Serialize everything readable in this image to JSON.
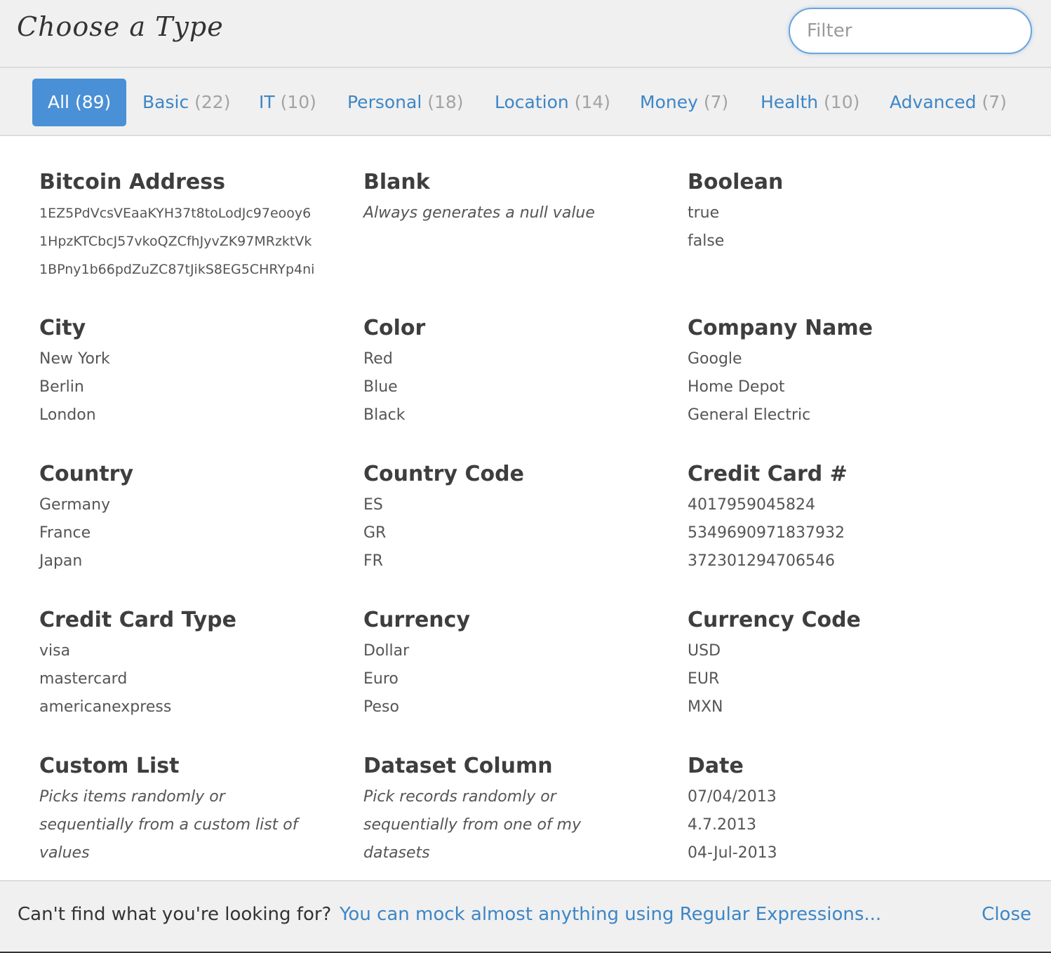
{
  "header": {
    "title": "Choose a Type",
    "filter_placeholder": "Filter"
  },
  "tabs": [
    {
      "label": "All",
      "count": "(89)",
      "active": true
    },
    {
      "label": "Basic",
      "count": "(22)"
    },
    {
      "label": "IT",
      "count": "(10)"
    },
    {
      "label": "Personal",
      "count": "(18)"
    },
    {
      "label": "Location",
      "count": "(14)"
    },
    {
      "label": "Money",
      "count": "(7)"
    },
    {
      "label": "Health",
      "count": "(10)"
    },
    {
      "label": "Advanced",
      "count": "(7)"
    }
  ],
  "types": [
    {
      "name": "Bitcoin Address",
      "examples": [
        "1EZ5PdVcsVEaaKYH37t8toLodJc97eooy6",
        "1HpzKTCbcJ57vkoQZCfhJyvZK97MRzktVk",
        "1BPny1b66pdZuZC87tJikS8EG5CHRYp4ni"
      ]
    },
    {
      "name": "Blank",
      "description": "Always generates a null value"
    },
    {
      "name": "Boolean",
      "examples": [
        "true",
        "false"
      ]
    },
    {
      "name": "City",
      "examples": [
        "New York",
        "Berlin",
        "London"
      ]
    },
    {
      "name": "Color",
      "examples": [
        "Red",
        "Blue",
        "Black"
      ]
    },
    {
      "name": "Company Name",
      "examples": [
        "Google",
        "Home Depot",
        "General Electric"
      ]
    },
    {
      "name": "Country",
      "examples": [
        "Germany",
        "France",
        "Japan"
      ]
    },
    {
      "name": "Country Code",
      "examples": [
        "ES",
        "GR",
        "FR"
      ]
    },
    {
      "name": "Credit Card #",
      "examples": [
        "4017959045824",
        "5349690971837932",
        "372301294706546"
      ]
    },
    {
      "name": "Credit Card Type",
      "examples": [
        "visa",
        "mastercard",
        "americanexpress"
      ]
    },
    {
      "name": "Currency",
      "examples": [
        "Dollar",
        "Euro",
        "Peso"
      ]
    },
    {
      "name": "Currency Code",
      "examples": [
        "USD",
        "EUR",
        "MXN"
      ]
    },
    {
      "name": "Custom List",
      "description": "Picks items randomly or sequentially from a custom list of values"
    },
    {
      "name": "Dataset Column",
      "description": "Pick records randomly or sequentially from one of my datasets"
    },
    {
      "name": "Date",
      "examples": [
        "07/04/2013",
        "4.7.2013",
        "04-Jul-2013"
      ]
    }
  ],
  "footer": {
    "question": "Can't find what you're looking for?",
    "regex_link": "You can mock almost anything using Regular Expressions...",
    "close_label": "Close"
  },
  "colors": {
    "accent": "#4a90d6",
    "link": "#3d86c6",
    "header_bg": "#f0f0f0"
  }
}
